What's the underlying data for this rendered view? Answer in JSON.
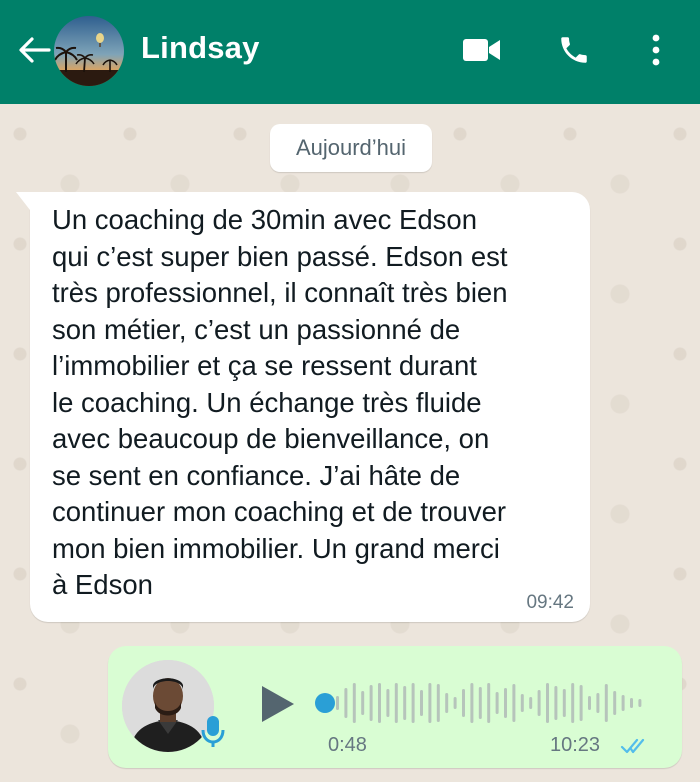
{
  "header": {
    "contact_name": "Lindsay",
    "background_color": "#008069",
    "icons": [
      "back-arrow-icon",
      "video-call-icon",
      "phone-call-icon",
      "more-options-icon"
    ]
  },
  "chat": {
    "date_chip": "Aujourd’hui",
    "incoming": {
      "lines": [
        "Un coaching de 30min avec Edson",
        "qui c’est super bien passé. Edson est",
        "très professionnel, il connaît très bien",
        "son métier, c’est un passionné de",
        "l’immobilier et ça se ressent durant",
        "le coaching. Un échange très fluide",
        "avec beaucoup de bienveillance, on",
        "se sent en confiance. J’ai hâte de",
        "continuer mon coaching et de trouver",
        "mon bien immobilier. Un grand merci",
        "à Edson"
      ],
      "time": "09:42"
    },
    "outgoing_voice": {
      "duration": "0:48",
      "time": "10:23",
      "progress": 0,
      "status": "read",
      "bubble_color": "#d9fdd3",
      "tick_color": "#53bdeb"
    }
  }
}
